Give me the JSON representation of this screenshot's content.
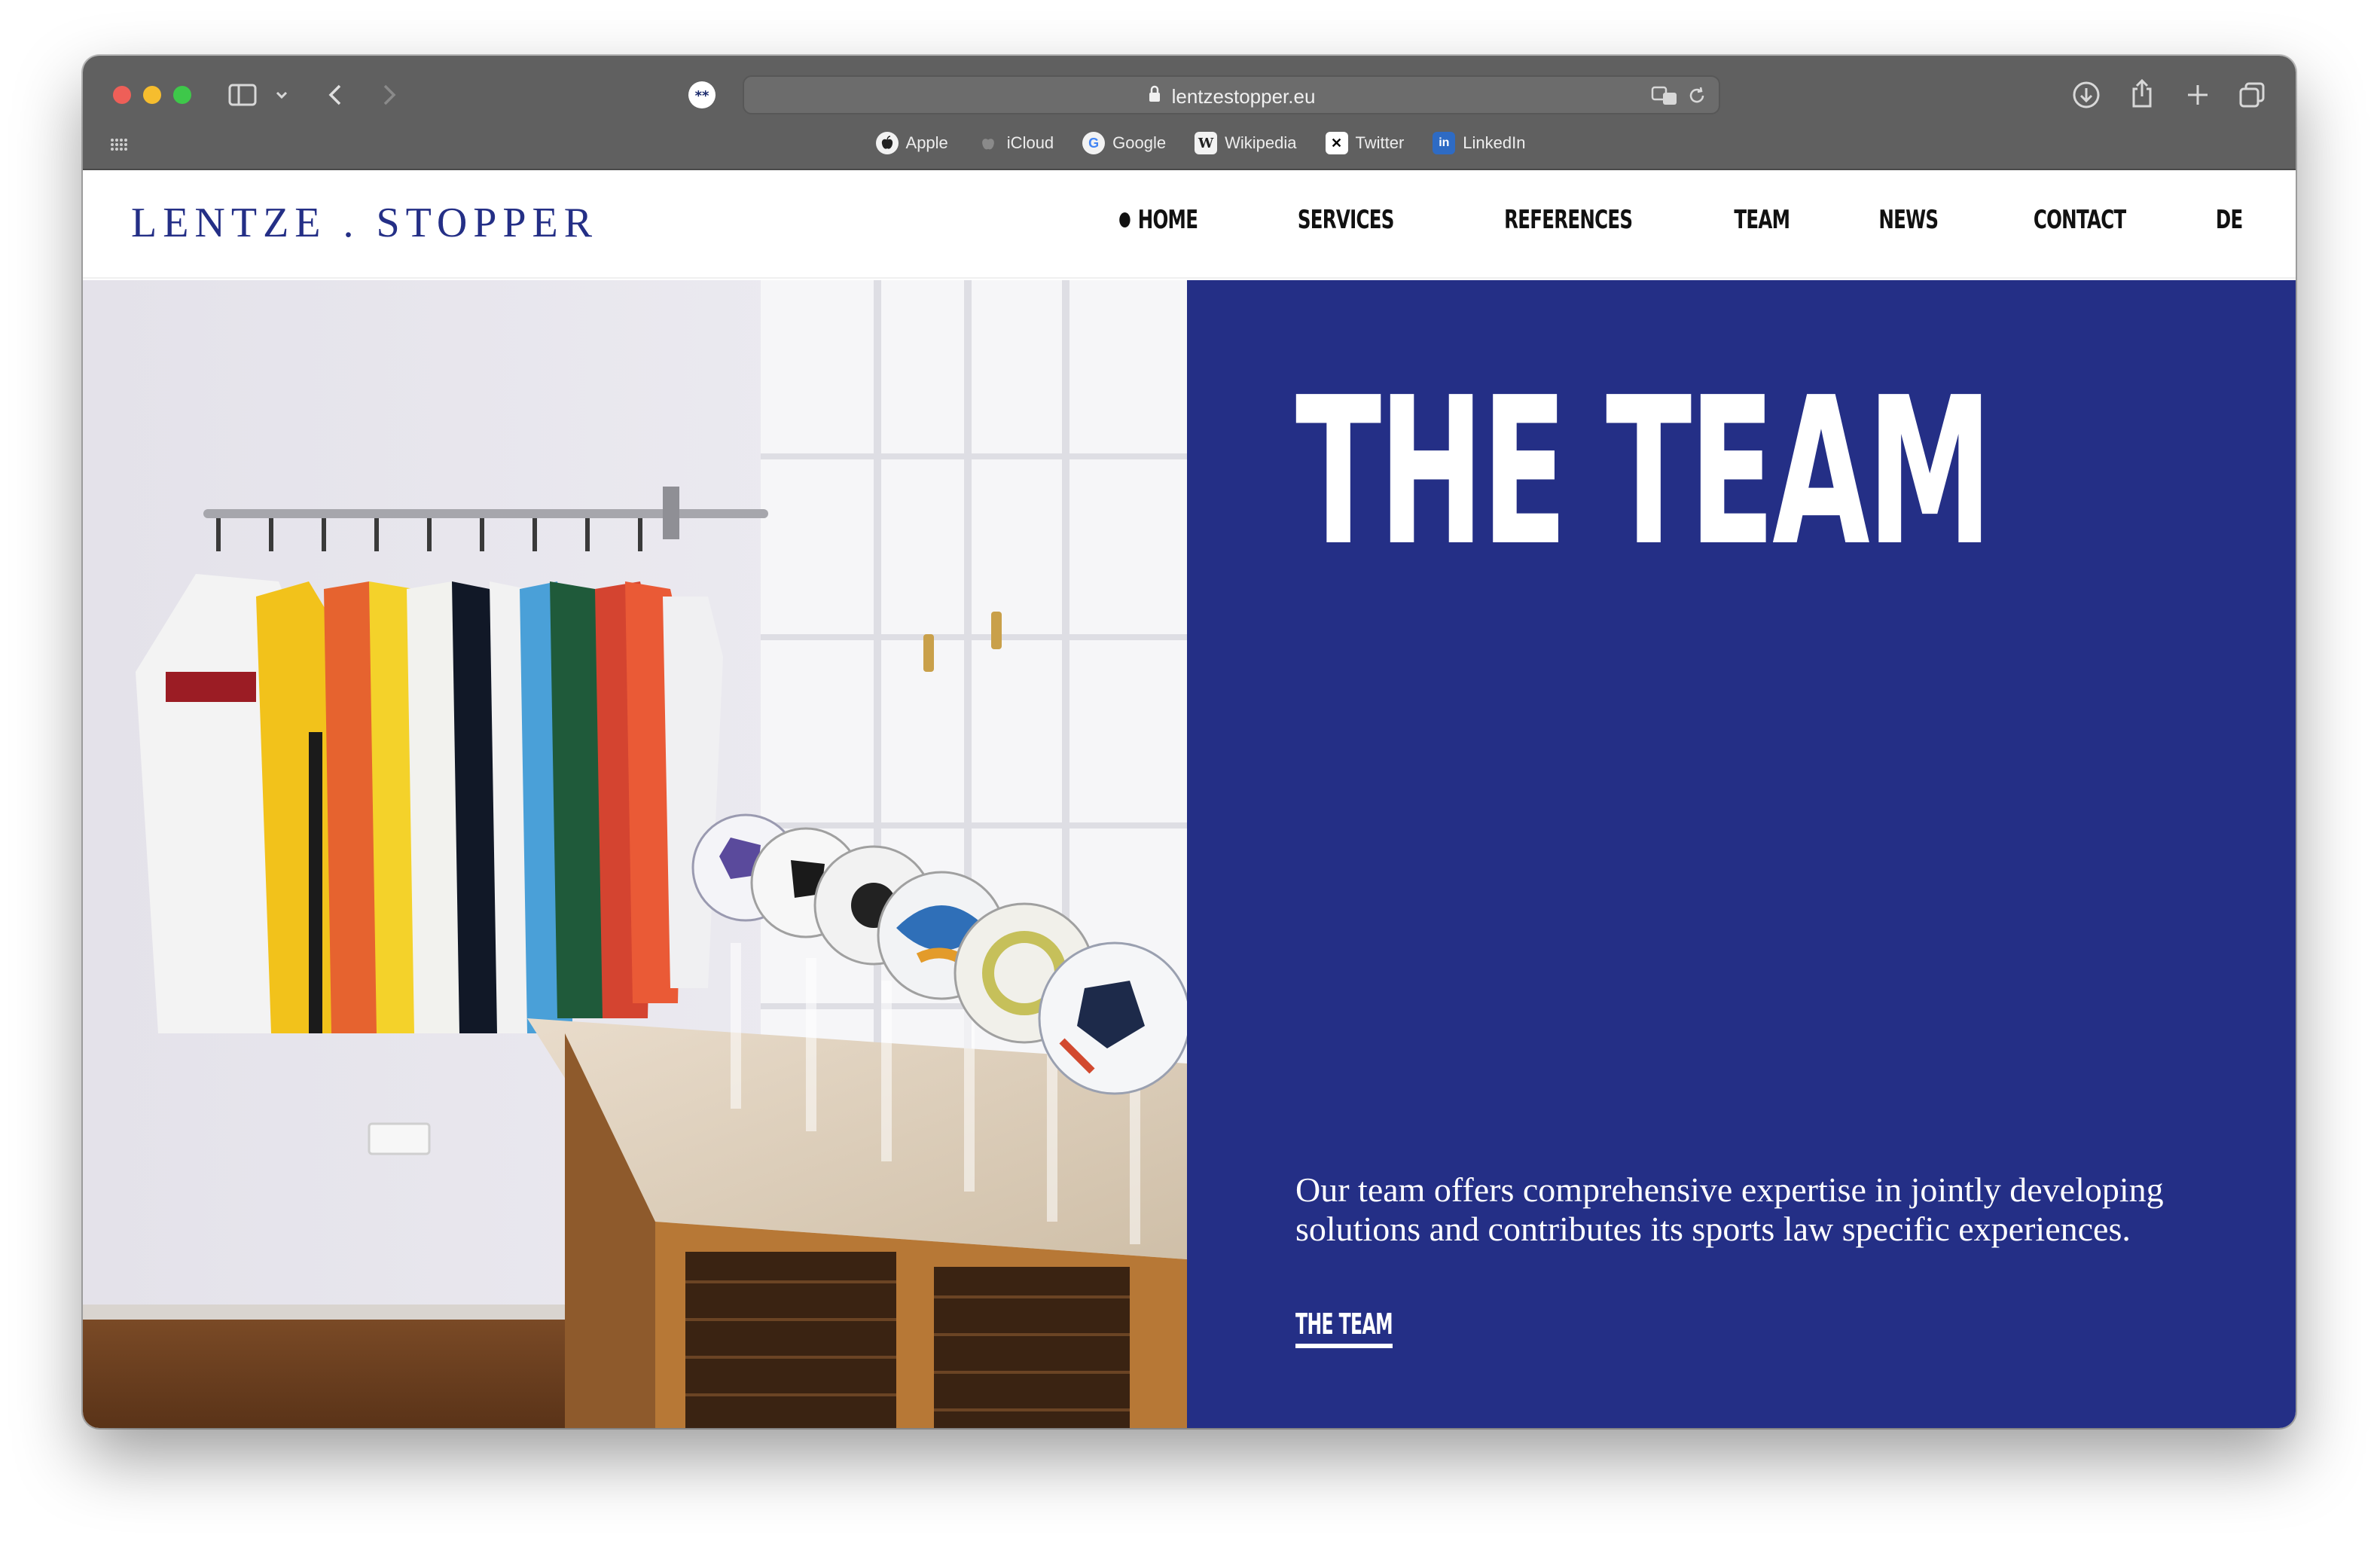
{
  "browser": {
    "url": "lentzestopper.eu",
    "bookmarks": [
      {
        "label": "Apple",
        "icon": "apple-icon"
      },
      {
        "label": "iCloud",
        "icon": "icloud-icon"
      },
      {
        "label": "Google",
        "icon": "google-icon"
      },
      {
        "label": "Wikipedia",
        "icon": "wikipedia-icon"
      },
      {
        "label": "Twitter",
        "icon": "x-icon"
      },
      {
        "label": "LinkedIn",
        "icon": "linkedin-icon"
      }
    ]
  },
  "site": {
    "logo": "LENTZE . STOPPER",
    "nav": [
      "HOME",
      "SERVICES",
      "REFERENCES",
      "TEAM",
      "NEWS",
      "CONTACT",
      "DE"
    ],
    "active_nav": "HOME"
  },
  "hero": {
    "headline": "THE TEAM",
    "lead": "Our team offers comprehensive expertise in jointly developing solutions and contributes its sports law specific experiences.",
    "cta": "THE TEAM"
  },
  "colors": {
    "brand_blue": "#242f86",
    "chrome_gray": "#606060"
  }
}
